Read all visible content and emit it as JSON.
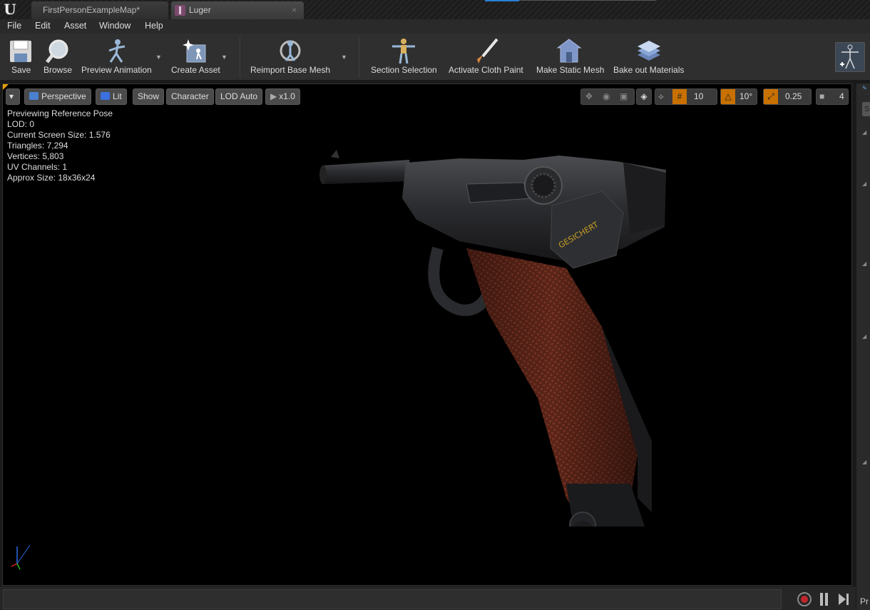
{
  "tabs": [
    {
      "label": "FirstPersonExampleMap*"
    },
    {
      "label": "Luger",
      "close": "×"
    }
  ],
  "menu": [
    "File",
    "Edit",
    "Asset",
    "Window",
    "Help"
  ],
  "toolbar": {
    "save": "Save",
    "browse": "Browse",
    "preview_animation": "Preview Animation",
    "create_asset": "Create Asset",
    "reimport": "Reimport Base Mesh",
    "section_selection": "Section Selection",
    "cloth_paint": "Activate Cloth Paint",
    "make_static_mesh": "Make Static Mesh",
    "bake_materials": "Bake out Materials"
  },
  "viewport": {
    "perspective": "Perspective",
    "lit": "Lit",
    "show": "Show",
    "character": "Character",
    "lod": "LOD Auto",
    "speed": "x1.0",
    "stats": [
      "Previewing Reference Pose",
      "LOD: 0",
      "Current Screen Size: 1.576",
      "Triangles: 7,294",
      "Vertices: 5,803",
      "UV Channels: 1",
      "Approx Size: 18x36x24"
    ],
    "grid_snap": "10",
    "rot_snap": "10°",
    "scale_snap": "0.25",
    "cam_speed": "4",
    "engraving": "GESICHERT"
  },
  "right_panel": {
    "search_placeholder": "S"
  },
  "bottom": {
    "label": "Pr"
  },
  "colors": {
    "accent_orange": "#c87000",
    "tab_accent": "#2a7fd4",
    "record_red": "#c0272d"
  }
}
